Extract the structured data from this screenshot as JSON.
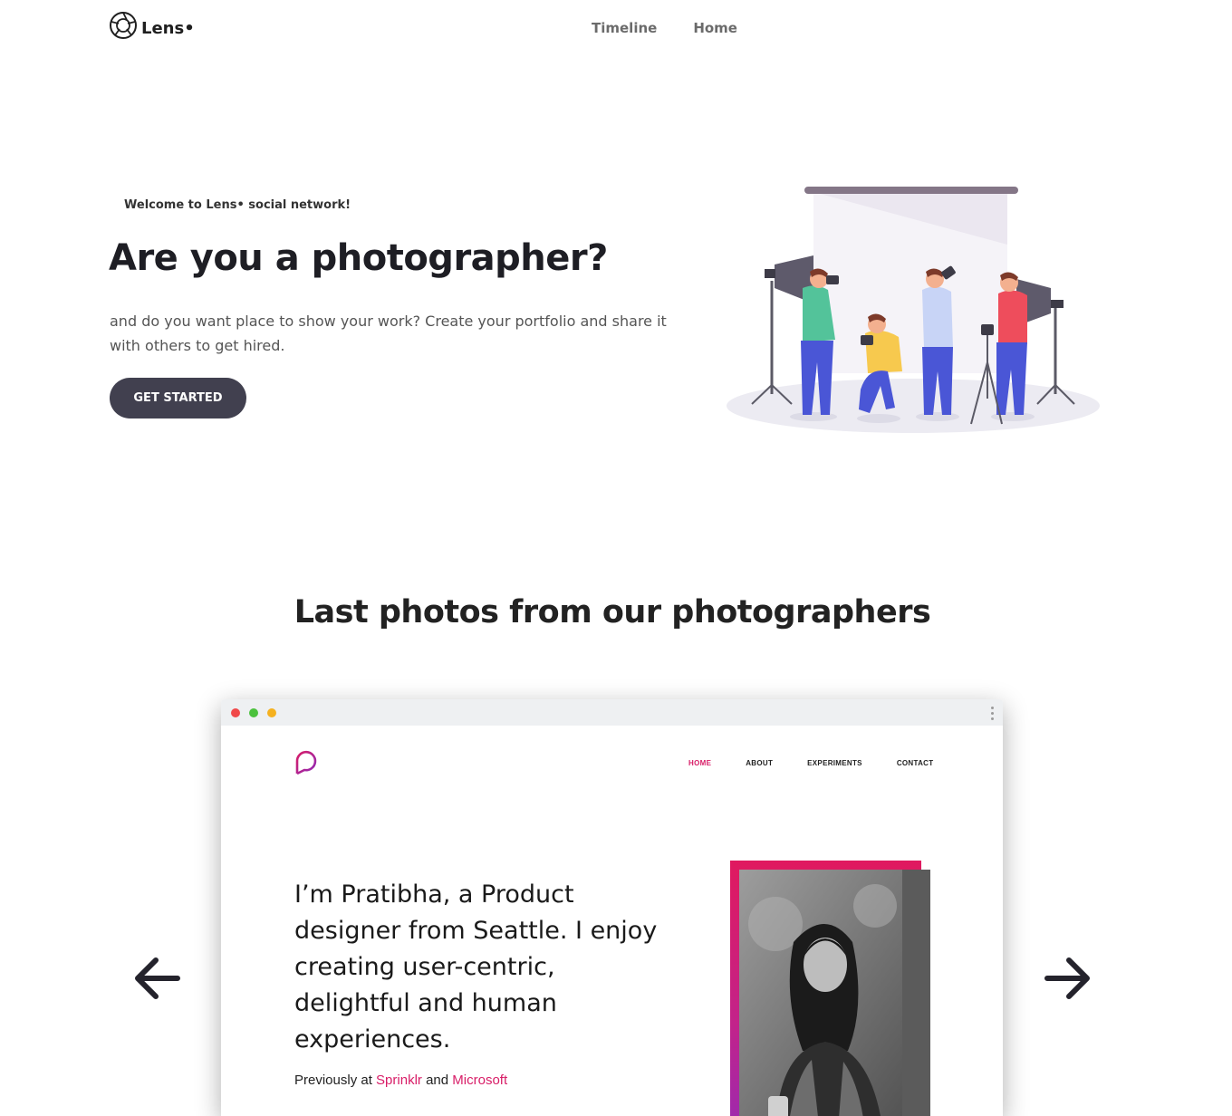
{
  "header": {
    "logo_text": "Lens•",
    "nav": [
      "Timeline",
      "Home"
    ]
  },
  "hero": {
    "welcome": "Welcome to Lens• social network!",
    "title": "Are you a photographer?",
    "subtitle": "and do you want place to show your work? Create your portfolio and share it with others to get hired.",
    "cta": "GET STARTED"
  },
  "gallery": {
    "title": "Last photos from our photographers",
    "preview": {
      "nav": [
        "HOME",
        "ABOUT",
        "EXPERIMENTS",
        "CONTACT"
      ],
      "active_nav": "HOME",
      "headline": "I’m Pratibha, a Product designer from Seattle. I enjoy creating user-centric, delightful and human experiences.",
      "previously_prefix": "Previously at",
      "previously_company_1": "Sprinklr",
      "previously_and": "and",
      "previously_company_2": "Microsoft"
    }
  },
  "colors": {
    "button_bg": "#41404f",
    "accent": "#d81d67",
    "frame_gradient_start": "#e0195f",
    "frame_gradient_end": "#9b2ab0"
  },
  "icons": [
    "aperture-icon",
    "chat-bubble-logo-icon",
    "arrow-left-icon",
    "arrow-right-icon"
  ]
}
